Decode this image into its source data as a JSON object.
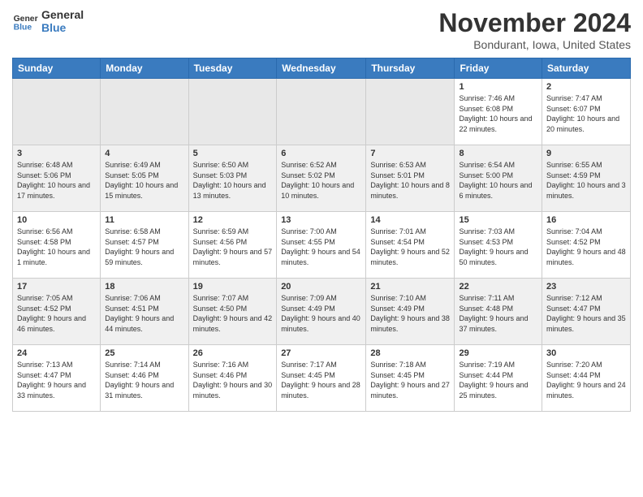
{
  "header": {
    "logo_line1": "General",
    "logo_line2": "Blue",
    "title": "November 2024",
    "location": "Bondurant, Iowa, United States"
  },
  "weekdays": [
    "Sunday",
    "Monday",
    "Tuesday",
    "Wednesday",
    "Thursday",
    "Friday",
    "Saturday"
  ],
  "weeks": [
    [
      {
        "day": "",
        "empty": true
      },
      {
        "day": "",
        "empty": true
      },
      {
        "day": "",
        "empty": true
      },
      {
        "day": "",
        "empty": true
      },
      {
        "day": "",
        "empty": true
      },
      {
        "day": "1",
        "sunrise": "7:46 AM",
        "sunset": "6:08 PM",
        "daylight": "10 hours and 22 minutes."
      },
      {
        "day": "2",
        "sunrise": "7:47 AM",
        "sunset": "6:07 PM",
        "daylight": "10 hours and 20 minutes."
      }
    ],
    [
      {
        "day": "3",
        "sunrise": "6:48 AM",
        "sunset": "5:06 PM",
        "daylight": "10 hours and 17 minutes."
      },
      {
        "day": "4",
        "sunrise": "6:49 AM",
        "sunset": "5:05 PM",
        "daylight": "10 hours and 15 minutes."
      },
      {
        "day": "5",
        "sunrise": "6:50 AM",
        "sunset": "5:03 PM",
        "daylight": "10 hours and 13 minutes."
      },
      {
        "day": "6",
        "sunrise": "6:52 AM",
        "sunset": "5:02 PM",
        "daylight": "10 hours and 10 minutes."
      },
      {
        "day": "7",
        "sunrise": "6:53 AM",
        "sunset": "5:01 PM",
        "daylight": "10 hours and 8 minutes."
      },
      {
        "day": "8",
        "sunrise": "6:54 AM",
        "sunset": "5:00 PM",
        "daylight": "10 hours and 6 minutes."
      },
      {
        "day": "9",
        "sunrise": "6:55 AM",
        "sunset": "4:59 PM",
        "daylight": "10 hours and 3 minutes."
      }
    ],
    [
      {
        "day": "10",
        "sunrise": "6:56 AM",
        "sunset": "4:58 PM",
        "daylight": "10 hours and 1 minute."
      },
      {
        "day": "11",
        "sunrise": "6:58 AM",
        "sunset": "4:57 PM",
        "daylight": "9 hours and 59 minutes."
      },
      {
        "day": "12",
        "sunrise": "6:59 AM",
        "sunset": "4:56 PM",
        "daylight": "9 hours and 57 minutes."
      },
      {
        "day": "13",
        "sunrise": "7:00 AM",
        "sunset": "4:55 PM",
        "daylight": "9 hours and 54 minutes."
      },
      {
        "day": "14",
        "sunrise": "7:01 AM",
        "sunset": "4:54 PM",
        "daylight": "9 hours and 52 minutes."
      },
      {
        "day": "15",
        "sunrise": "7:03 AM",
        "sunset": "4:53 PM",
        "daylight": "9 hours and 50 minutes."
      },
      {
        "day": "16",
        "sunrise": "7:04 AM",
        "sunset": "4:52 PM",
        "daylight": "9 hours and 48 minutes."
      }
    ],
    [
      {
        "day": "17",
        "sunrise": "7:05 AM",
        "sunset": "4:52 PM",
        "daylight": "9 hours and 46 minutes."
      },
      {
        "day": "18",
        "sunrise": "7:06 AM",
        "sunset": "4:51 PM",
        "daylight": "9 hours and 44 minutes."
      },
      {
        "day": "19",
        "sunrise": "7:07 AM",
        "sunset": "4:50 PM",
        "daylight": "9 hours and 42 minutes."
      },
      {
        "day": "20",
        "sunrise": "7:09 AM",
        "sunset": "4:49 PM",
        "daylight": "9 hours and 40 minutes."
      },
      {
        "day": "21",
        "sunrise": "7:10 AM",
        "sunset": "4:49 PM",
        "daylight": "9 hours and 38 minutes."
      },
      {
        "day": "22",
        "sunrise": "7:11 AM",
        "sunset": "4:48 PM",
        "daylight": "9 hours and 37 minutes."
      },
      {
        "day": "23",
        "sunrise": "7:12 AM",
        "sunset": "4:47 PM",
        "daylight": "9 hours and 35 minutes."
      }
    ],
    [
      {
        "day": "24",
        "sunrise": "7:13 AM",
        "sunset": "4:47 PM",
        "daylight": "9 hours and 33 minutes."
      },
      {
        "day": "25",
        "sunrise": "7:14 AM",
        "sunset": "4:46 PM",
        "daylight": "9 hours and 31 minutes."
      },
      {
        "day": "26",
        "sunrise": "7:16 AM",
        "sunset": "4:46 PM",
        "daylight": "9 hours and 30 minutes."
      },
      {
        "day": "27",
        "sunrise": "7:17 AM",
        "sunset": "4:45 PM",
        "daylight": "9 hours and 28 minutes."
      },
      {
        "day": "28",
        "sunrise": "7:18 AM",
        "sunset": "4:45 PM",
        "daylight": "9 hours and 27 minutes."
      },
      {
        "day": "29",
        "sunrise": "7:19 AM",
        "sunset": "4:44 PM",
        "daylight": "9 hours and 25 minutes."
      },
      {
        "day": "30",
        "sunrise": "7:20 AM",
        "sunset": "4:44 PM",
        "daylight": "9 hours and 24 minutes."
      }
    ]
  ],
  "labels": {
    "sunrise": "Sunrise:",
    "sunset": "Sunset:",
    "daylight": "Daylight:"
  }
}
